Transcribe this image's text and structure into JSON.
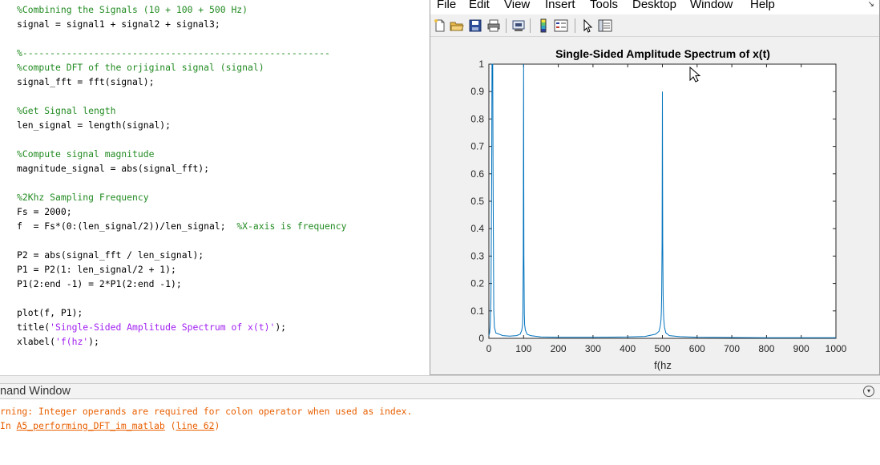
{
  "editor": {
    "lines": [
      {
        "text": "%Combining the Signals (10 + 100 + 500 Hz)",
        "kind": "comment"
      },
      {
        "text": "signal = signal1 + signal2 + signal3;",
        "kind": "code"
      },
      {
        "text": "",
        "kind": "code"
      },
      {
        "text": "%--------------------------------------------------------",
        "kind": "comment"
      },
      {
        "text": "%compute DFT of the orjiginal signal (signal)",
        "kind": "comment"
      },
      {
        "text": "signal_fft = fft(signal);",
        "kind": "code"
      },
      {
        "text": "",
        "kind": "code"
      },
      {
        "text": "%Get Signal length",
        "kind": "comment"
      },
      {
        "text": "len_signal = length(signal);",
        "kind": "code"
      },
      {
        "text": "",
        "kind": "code"
      },
      {
        "text": "%Compute signal magnitude",
        "kind": "comment"
      },
      {
        "text": "magnitude_signal = abs(signal_fft);",
        "kind": "code"
      },
      {
        "text": "",
        "kind": "code"
      },
      {
        "text": "%2Khz Sampling Frequency",
        "kind": "comment"
      },
      {
        "text": "Fs = 2000;",
        "kind": "code"
      },
      {
        "text": "f  = Fs*(0:(len_signal/2))/len_signal;  ",
        "kind": "code",
        "trailing_comment": "%X-axis is frequency"
      },
      {
        "text": "",
        "kind": "code"
      },
      {
        "text": "P2 = abs(signal_fft / len_signal);",
        "kind": "code"
      },
      {
        "text": "P1 = P2(1: len_signal/2 + 1);",
        "kind": "code"
      },
      {
        "text": "P1(2:end -1) = 2*P1(2:end -1);",
        "kind": "code"
      },
      {
        "text": "",
        "kind": "code"
      },
      {
        "text": "plot(f, P1);",
        "kind": "code"
      },
      {
        "text": "title(",
        "kind": "code",
        "string": "'Single-Sided Amplitude Spectrum of x(t)'",
        "after": ");"
      },
      {
        "text": "xlabel(",
        "kind": "code",
        "string": "'f(hz'",
        "after": ");"
      }
    ]
  },
  "figure": {
    "menus": [
      "File",
      "Edit",
      "View",
      "Insert",
      "Tools",
      "Desktop",
      "Window",
      "Help"
    ],
    "resize_glyph": "↘",
    "toolbar_icons": [
      "new-figure-icon",
      "open-file-icon",
      "save-icon",
      "print-icon",
      "print-preview-icon",
      "colorbar-icon",
      "legend-icon",
      "pointer-icon",
      "property-editor-icon"
    ],
    "colors": {
      "line": "#0072bd",
      "axes_bg": "#ffffff",
      "figure_bg": "#f0f0f0"
    }
  },
  "chart_data": {
    "type": "line",
    "title": "Single-Sided Amplitude Spectrum of x(t)",
    "xlabel": "f(hz",
    "ylabel": "",
    "xlim": [
      0,
      1000
    ],
    "ylim": [
      0,
      1
    ],
    "xticks": [
      0,
      100,
      200,
      300,
      400,
      500,
      600,
      700,
      800,
      900,
      1000
    ],
    "yticks": [
      0,
      0.1,
      0.2,
      0.3,
      0.4,
      0.5,
      0.6,
      0.7,
      0.8,
      0.9,
      1
    ],
    "xtick_labels": [
      "0",
      "100",
      "200",
      "300",
      "400",
      "500",
      "600",
      "700",
      "800",
      "900",
      "1000"
    ],
    "ytick_labels": [
      "0",
      "0.1",
      "0.2",
      "0.3",
      "0.4",
      "0.5",
      "0.6",
      "0.7",
      "0.8",
      "0.9",
      "1"
    ],
    "grid": false,
    "series": [
      {
        "peaks": [
          {
            "f": 10,
            "amplitude": 1.0
          },
          {
            "f": 100,
            "amplitude": 1.0
          },
          {
            "f": 500,
            "amplitude": 0.9
          }
        ],
        "x": [
          0,
          2,
          4,
          6,
          8,
          9,
          10,
          11,
          12,
          14,
          16,
          20,
          40,
          60,
          80,
          90,
          95,
          97,
          98,
          99,
          100,
          101,
          102,
          103,
          105,
          110,
          120,
          150,
          200,
          300,
          400,
          450,
          480,
          490,
          494,
          496,
          497,
          498,
          499,
          500,
          501,
          502,
          503,
          504,
          506,
          510,
          520,
          550,
          600,
          700,
          800,
          900,
          1000
        ],
        "y": [
          0.01,
          0.02,
          0.05,
          0.15,
          0.6,
          1.0,
          1.0,
          1.0,
          0.6,
          0.1,
          0.04,
          0.02,
          0.01,
          0.008,
          0.01,
          0.015,
          0.03,
          0.05,
          0.09,
          0.3,
          1.0,
          0.3,
          0.09,
          0.05,
          0.03,
          0.015,
          0.01,
          0.005,
          0.004,
          0.004,
          0.005,
          0.007,
          0.015,
          0.025,
          0.045,
          0.07,
          0.1,
          0.16,
          0.35,
          0.9,
          0.35,
          0.16,
          0.1,
          0.07,
          0.04,
          0.02,
          0.01,
          0.006,
          0.004,
          0.003,
          0.002,
          0.002,
          0.002
        ]
      }
    ]
  },
  "cursor": {
    "icon": "mouse-pointer-icon"
  },
  "command_window": {
    "title": "nand Window",
    "menu_glyph": "▾",
    "warning_text": "rning: Integer operands are required for colon operator when used as index.",
    "location_prefix": "In ",
    "link_file": "A5_performing_DFT_im_matlab",
    "link_line": "line 62",
    "location_suffix": ")"
  }
}
